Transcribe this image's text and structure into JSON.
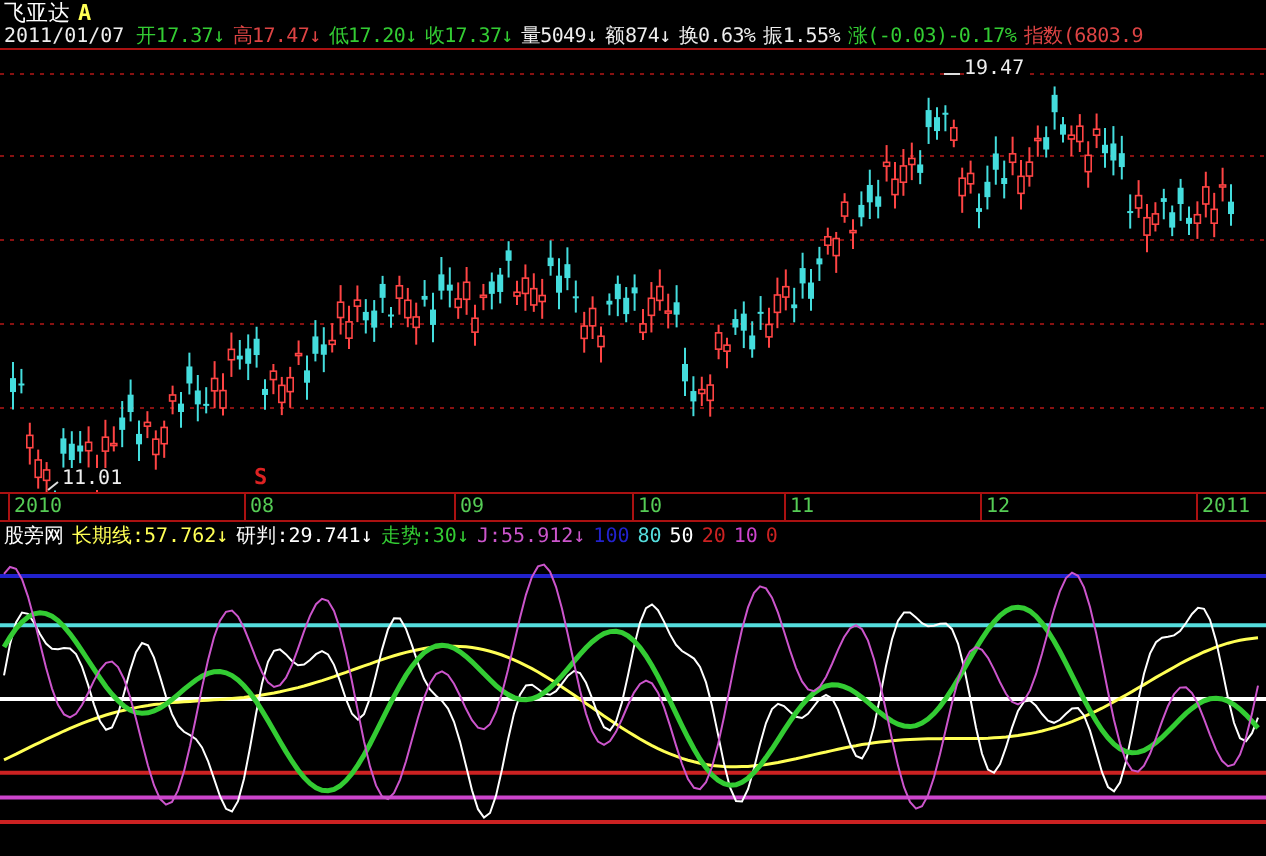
{
  "stock": {
    "name": "飞亚达",
    "badge": "A"
  },
  "date": "2011/01/07",
  "quote": [
    {
      "label": "开",
      "value": "17.37",
      "arrow": "↓",
      "color": "#33cc33"
    },
    {
      "label": "高",
      "value": "17.47",
      "arrow": "↓",
      "color": "#dd4444"
    },
    {
      "label": "低",
      "value": "17.20",
      "arrow": "↓",
      "color": "#33cc33"
    },
    {
      "label": "收",
      "value": "17.37",
      "arrow": "↓",
      "color": "#33cc33"
    },
    {
      "label": "量",
      "value": "5049",
      "arrow": "↓",
      "color": "#eeeeee"
    },
    {
      "label": "额",
      "value": "874",
      "arrow": "↓",
      "color": "#eeeeee"
    },
    {
      "label": "换",
      "value": "0.63%",
      "color": "#eeeeee"
    },
    {
      "label": "振",
      "value": "1.55%",
      "color": "#eeeeee"
    },
    {
      "label": "涨",
      "value": "(-0.03)-0.17%",
      "color": "#33cc33"
    },
    {
      "label": "指数",
      "value": "(6803.9",
      "color": "#dd4444"
    }
  ],
  "chart": {
    "high_label": "19.47",
    "low_label": "11.01",
    "signal": "S"
  },
  "axis": [
    "2010",
    "08",
    "09",
    "10",
    "11",
    "12",
    "2011"
  ],
  "indicator": {
    "source": "股旁网",
    "series": [
      {
        "label": "长期线:57.762",
        "arrow": "↓",
        "color": "#ffff55"
      },
      {
        "label": "研判:29.741",
        "arrow": "↓",
        "color": "#ffffff"
      },
      {
        "label": "走势:30",
        "arrow": "↓",
        "color": "#33cc33"
      },
      {
        "label": "J:55.912",
        "arrow": "↓",
        "color": "#cc55cc"
      }
    ],
    "levels": [
      {
        "label": "100",
        "color": "#2222cc"
      },
      {
        "label": "80",
        "color": "#55dddd"
      },
      {
        "label": "50",
        "color": "#ffffff"
      },
      {
        "label": "20",
        "color": "#cc2222"
      },
      {
        "label": "10",
        "color": "#cc44cc"
      },
      {
        "label": "0",
        "color": "#cc2222"
      }
    ]
  }
}
